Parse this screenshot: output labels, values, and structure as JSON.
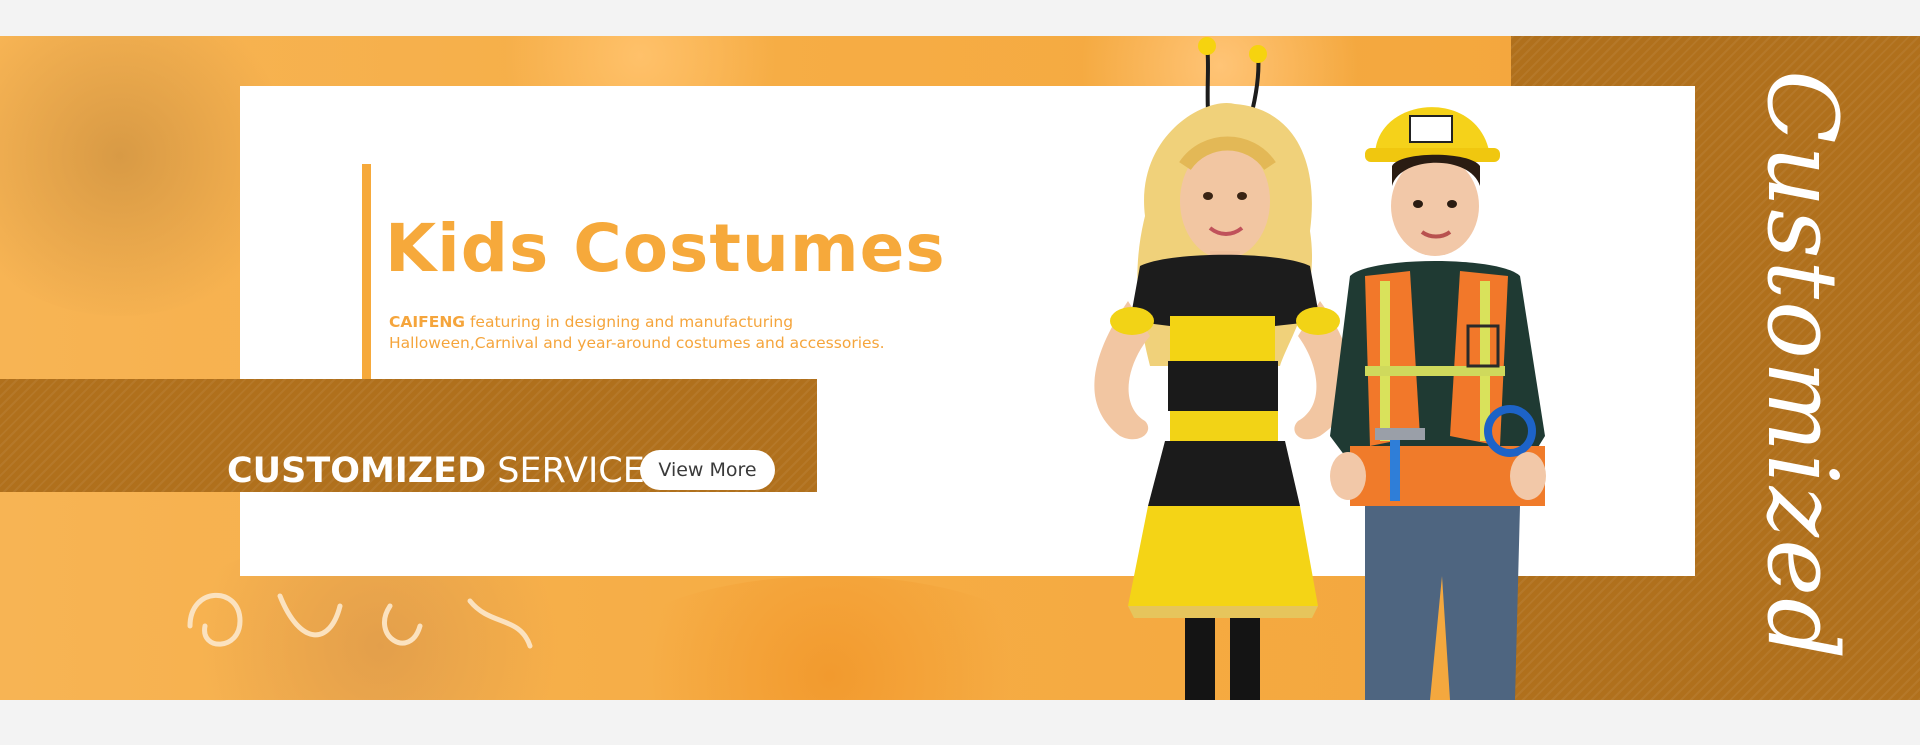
{
  "banner": {
    "title": "Kids Costumes",
    "brand": "CAIFENG",
    "description_line1_rest": "featuring in designing and manufacturing",
    "description_line2": "Halloween,Carnival and year-around costumes and accessories.",
    "service_strong": "CUSTOMIZED",
    "service_light": "SERVICE",
    "view_more_label": "View More",
    "side_word": "Customized"
  },
  "colors": {
    "orange_bg": "#f6ad45",
    "accent_orange": "#f6a93b",
    "brown_band": "#b0701c",
    "white": "#ffffff"
  },
  "images": {
    "kids_photo": "girl in bee costume and boy in construction worker costume"
  }
}
